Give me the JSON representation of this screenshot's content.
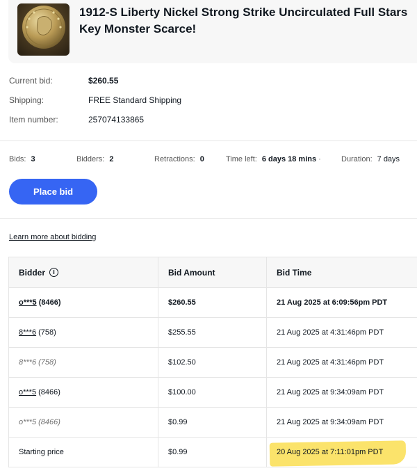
{
  "listing": {
    "title": "1912-S Liberty Nickel Strong Strike Uncirculated Full Stars Key Monster Scarce!"
  },
  "details": [
    {
      "label": "Current bid:",
      "value": "$260.55"
    },
    {
      "label": "Shipping:",
      "value": "FREE Standard Shipping"
    },
    {
      "label": "Item number:",
      "value": "257074133865"
    }
  ],
  "stats": {
    "bids_label": "Bids:",
    "bids_value": "3",
    "bidders_label": "Bidders:",
    "bidders_value": "2",
    "retractions_label": "Retractions:",
    "retractions_value": "0",
    "time_left_label": "Time left:",
    "time_left_value": "6 days 18 mins",
    "duration_label": "Duration:",
    "duration_value": "7 days"
  },
  "place_bid_label": "Place bid",
  "learn_more_label": "Learn more about bidding",
  "table": {
    "headers": [
      "Bidder",
      "Bid Amount",
      "Bid Time"
    ],
    "rows": [
      {
        "bidder": "o***5",
        "feedback": "(8466)",
        "amount": "$260.55",
        "time": "21 Aug 2025 at 6:09:56pm PDT"
      },
      {
        "bidder": "8***6",
        "feedback": "(758)",
        "amount": "$255.55",
        "time": "21 Aug 2025 at 4:31:46pm PDT"
      },
      {
        "bidder": "8***6",
        "feedback": "(758)",
        "amount": "$102.50",
        "time": "21 Aug 2025 at 4:31:46pm PDT"
      },
      {
        "bidder": "o***5",
        "feedback": "(8466)",
        "amount": "$100.00",
        "time": "21 Aug 2025 at 9:34:09am PDT"
      },
      {
        "bidder": "o***5",
        "feedback": "(8466)",
        "amount": "$0.99",
        "time": "21 Aug 2025 at 9:34:09am PDT"
      }
    ],
    "starting_row": {
      "label": "Starting price",
      "amount": "$0.99",
      "time": "20 Aug 2025 at 7:11:01pm PDT"
    }
  },
  "colors": {
    "accent": "#3665f3",
    "highlight": "#fbe36b"
  }
}
